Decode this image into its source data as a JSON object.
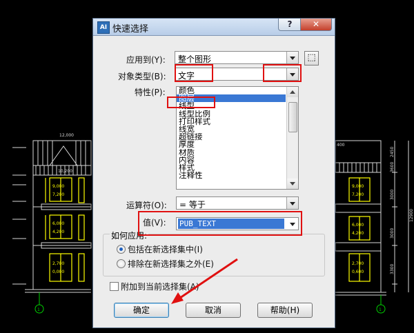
{
  "cad_drawing": {
    "dimensions_top": [
      "12,000",
      "10,200",
      "400"
    ],
    "left_level_marks": [
      "9,000",
      "7,200",
      "6,000",
      "4,200",
      "2,700",
      "0,000"
    ],
    "right_level_marks": [
      "9,000",
      "7,200",
      "6,000",
      "4,200",
      "2,700",
      "0,600"
    ],
    "right_dimensions": [
      "2450",
      "3600",
      "3000",
      "3000",
      "3300",
      "12900"
    ],
    "axis_label": "1"
  },
  "dialog": {
    "app_icon_text": "AI",
    "title": "快速选择",
    "help_glyph": "?",
    "close_glyph": "✕",
    "apply_to": {
      "label": "应用到(Y):",
      "value": "整个图形"
    },
    "object_type": {
      "label": "对象类型(B):",
      "value": "文字"
    },
    "properties": {
      "label": "特性(P):",
      "items": [
        "颜色",
        "图层",
        "线型",
        "线型比例",
        "打印样式",
        "线宽",
        "超链接",
        "厚度",
        "材质",
        "内容",
        "样式",
        "注释性"
      ],
      "selected_index": 1
    },
    "operator": {
      "label": "运算符(O):",
      "value": "= 等于"
    },
    "value": {
      "label": "值(V):",
      "value": "PUB_TEXT"
    },
    "how_to_apply": {
      "legend": "如何应用:",
      "include": "包括在新选择集中(I)",
      "exclude": "排除在新选择集之外(E)"
    },
    "append_label": "附加到当前选择集(A)",
    "buttons": {
      "ok": "确定",
      "cancel": "取消",
      "help": "帮助(H)"
    }
  },
  "colors": {
    "accent": "#3a78d4",
    "annotation": "#e01010",
    "cad_background": "#000000",
    "cad_yellow": "#ffff00"
  }
}
